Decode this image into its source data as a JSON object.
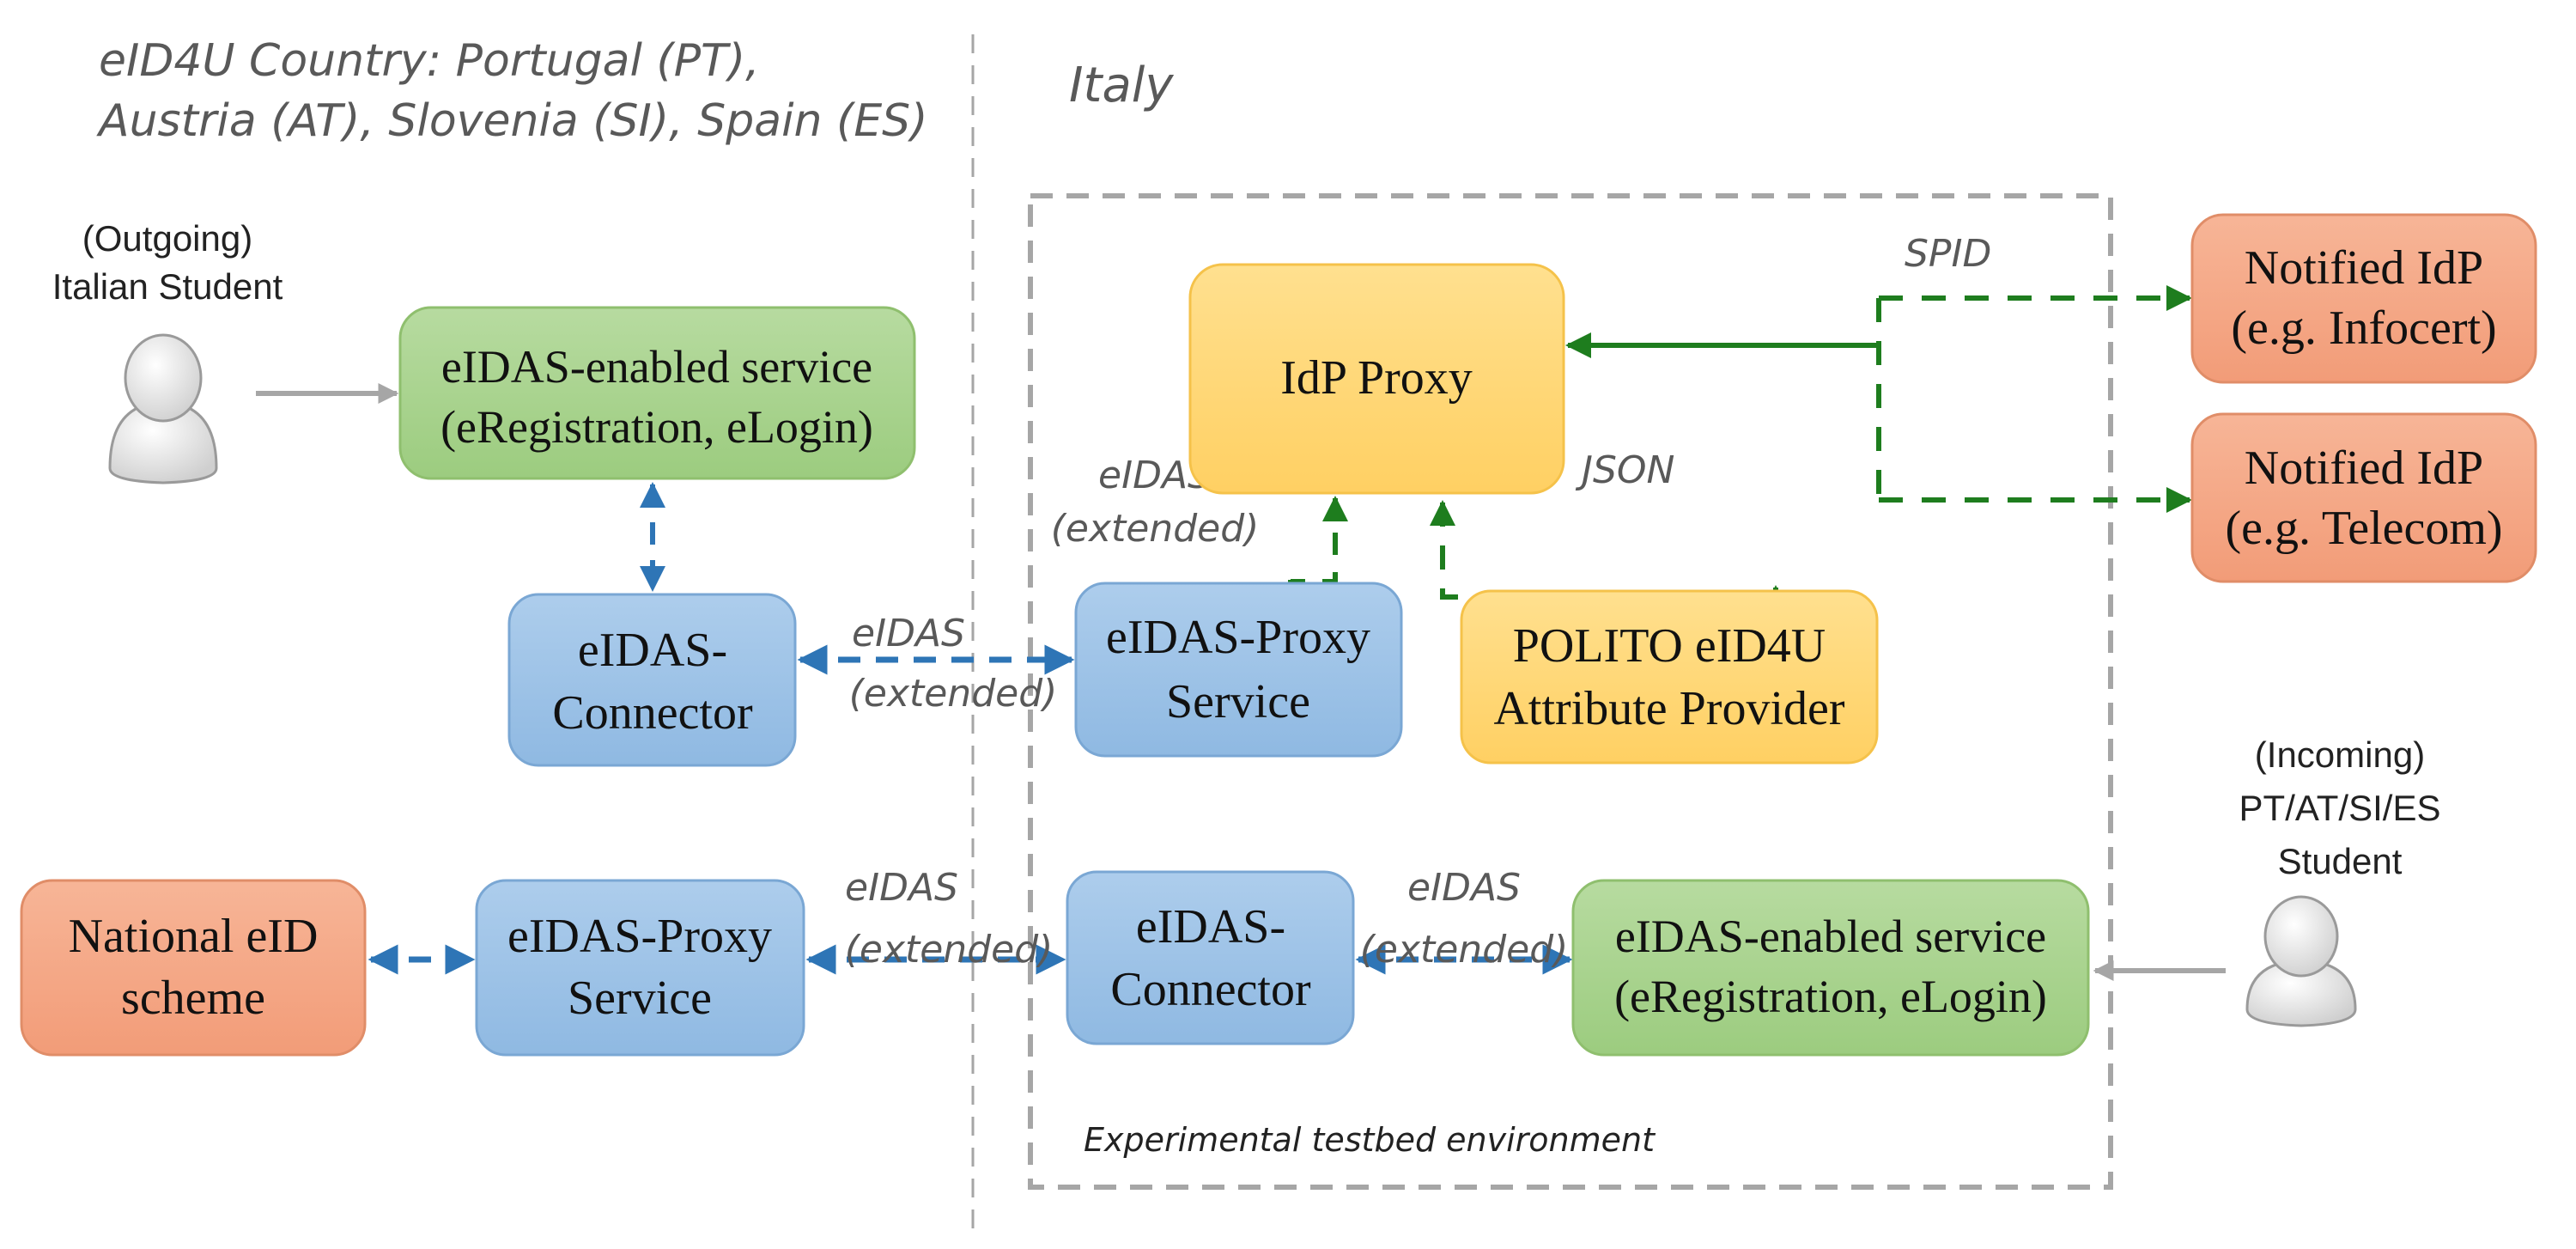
{
  "regions": {
    "eid4u_country_line1": "eID4U Country:  Portugal (PT),",
    "eid4u_country_line2": "Austria (AT), Slovenia (SI), Spain (ES)",
    "italy": "Italy",
    "testbed": "Experimental testbed environment"
  },
  "actors": {
    "outgoing": {
      "line1": "(Outgoing)",
      "line2": "Italian Student",
      "icon": "user-icon"
    },
    "incoming": {
      "line1": "(Incoming)",
      "line2": "PT/AT/SI/ES",
      "line3": "Student",
      "icon": "user-icon"
    }
  },
  "nodes": {
    "service_top": {
      "line1": "eIDAS-enabled service",
      "line2": "(eRegistration, eLogin)"
    },
    "connector_top": {
      "line1": "eIDAS-",
      "line2": "Connector"
    },
    "proxy_service_top": {
      "line1": "eIDAS-Proxy",
      "line2": "Service"
    },
    "idp_proxy": {
      "line1": "IdP Proxy"
    },
    "polito": {
      "line1": "POLITO eID4U",
      "line2": "Attribute Provider"
    },
    "notified_infocert": {
      "line1": "Notified IdP",
      "line2": "(e.g. Infocert)"
    },
    "notified_telecom": {
      "line1": "Notified IdP",
      "line2": "(e.g. Telecom)"
    },
    "national_eid": {
      "line1": "National eID",
      "line2": "scheme"
    },
    "proxy_service_bottom": {
      "line1": "eIDAS-Proxy",
      "line2": "Service"
    },
    "connector_bottom": {
      "line1": "eIDAS-",
      "line2": "Connector"
    },
    "service_bottom": {
      "line1": "eIDAS-enabled service",
      "line2": "(eRegistration, eLogin)"
    }
  },
  "edge_labels": {
    "spid": "SPID",
    "json": "JSON",
    "eidas_idp": {
      "line1": "eIDAS",
      "line2": "(extended)"
    },
    "eidas_top": {
      "line1": "eIDAS",
      "line2": "(extended)"
    },
    "eidas_bottom_left": {
      "line1": "eIDAS",
      "line2": "(extended)"
    },
    "eidas_bottom_right": {
      "line1": "eIDAS",
      "line2": "(extended)"
    }
  },
  "colors": {
    "green_fill": "#a9d18e",
    "green_stroke": "#8fbf6e",
    "blue_fill": "#9dc3e6",
    "blue_stroke": "#7aa7d4",
    "yellow_fill": "#ffd97a",
    "yellow_stroke": "#f5c24a",
    "salmon_fill": "#f4a582",
    "salmon_stroke": "#e08d68",
    "green_edge": "#1e7d1e",
    "blue_edge": "#2e75b6",
    "gray_edge": "#a6a6a6"
  }
}
